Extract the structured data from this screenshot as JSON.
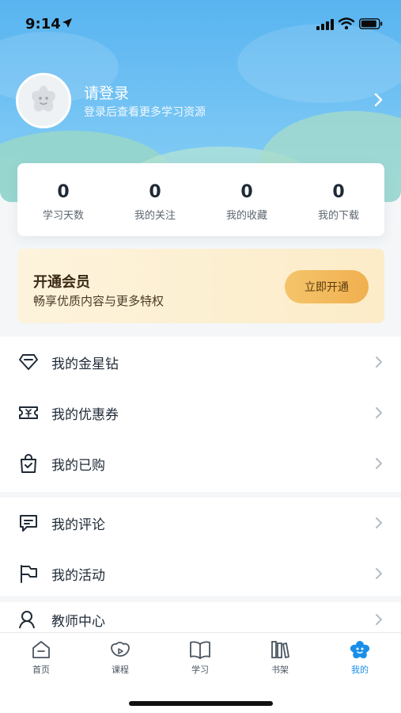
{
  "status_bar": {
    "time": "9:14"
  },
  "profile": {
    "title": "请登录",
    "subtitle": "登录后查看更多学习资源"
  },
  "stats": [
    {
      "value": "0",
      "label": "学习天数"
    },
    {
      "value": "0",
      "label": "我的关注"
    },
    {
      "value": "0",
      "label": "我的收藏"
    },
    {
      "value": "0",
      "label": "我的下载"
    }
  ],
  "vip": {
    "title": "开通会员",
    "subtitle": "畅享优质内容与更多特权",
    "button": "立即开通"
  },
  "menu": [
    {
      "label": "我的金星钻",
      "icon": "diamond-icon"
    },
    {
      "label": "我的优惠券",
      "icon": "coupon-icon"
    },
    {
      "label": "我的已购",
      "icon": "shopping-bag-icon"
    },
    {
      "label": "我的评论",
      "icon": "comment-icon"
    },
    {
      "label": "我的活动",
      "icon": "flag-icon"
    },
    {
      "label": "教师中心",
      "icon": "teacher-icon"
    }
  ],
  "tabs": [
    {
      "label": "首页",
      "icon": "home-icon"
    },
    {
      "label": "课程",
      "icon": "course-icon"
    },
    {
      "label": "学习",
      "icon": "book-icon"
    },
    {
      "label": "书架",
      "icon": "bookshelf-icon"
    },
    {
      "label": "我的",
      "icon": "profile-icon",
      "active": true
    }
  ],
  "colors": {
    "header": "#6ec0f3",
    "accent": "#1a8fe8",
    "vip_button": "#f0b04f",
    "vip_background": "#fcecc8"
  }
}
